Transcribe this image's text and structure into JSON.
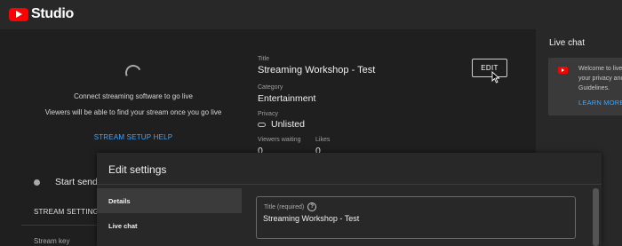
{
  "app": {
    "name": "Studio"
  },
  "stream_preview": {
    "connect_message": "Connect streaming software to go live",
    "viewers_message": "Viewers will be able to find your stream once you go live",
    "setup_help": "STREAM SETUP HELP"
  },
  "stream_info": {
    "title_label": "Title",
    "title_value": "Streaming Workshop - Test",
    "category_label": "Category",
    "category_value": "Entertainment",
    "privacy_label": "Privacy",
    "privacy_value": "Unlisted",
    "viewers_waiting_label": "Viewers waiting",
    "viewers_waiting_value": "0",
    "likes_label": "Likes",
    "likes_value": "0",
    "edit_button": "EDIT"
  },
  "start_row": {
    "label": "Start sendi"
  },
  "tabs": {
    "stream_settings": "STREAM SETTING"
  },
  "stream_key": {
    "label": "Stream key"
  },
  "live_chat": {
    "title": "Live chat",
    "welcome_text": "Welcome to live\nyour privacy and\nGuidelines.",
    "learn_more": "LEARN MORE"
  },
  "modal": {
    "title": "Edit settings",
    "nav": [
      {
        "label": "Details",
        "active": true
      },
      {
        "label": "Live chat",
        "active": false
      }
    ],
    "title_field": {
      "label": "Title (required)",
      "help_glyph": "?",
      "value": "Streaming Workshop - Test"
    }
  },
  "colors": {
    "brand_red": "#ff0000",
    "link_blue": "#3ea6ff",
    "background": "#1f1f1f",
    "panel": "#282828"
  },
  "icons": {
    "logo": "youtube-logo-icon",
    "spinner": "loading-spinner-icon",
    "privacy": "link-icon",
    "status": "status-dot-icon",
    "help": "help-circle-icon",
    "cursor": "mouse-cursor-icon"
  }
}
